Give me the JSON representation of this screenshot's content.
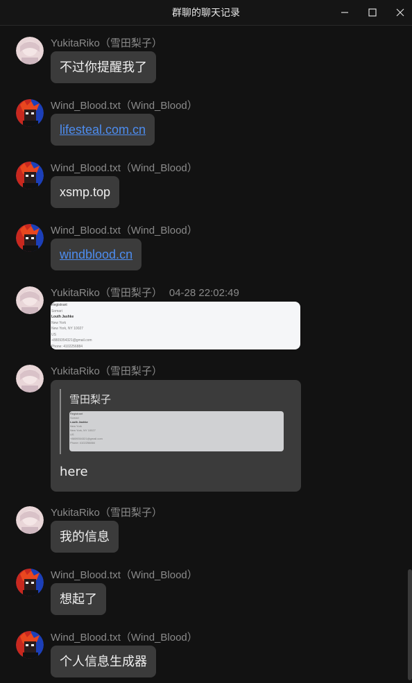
{
  "window": {
    "title": "群聊的聊天记录"
  },
  "messages": [
    {
      "sender": "YukitaRiko（雪田梨子）",
      "text": "不过你提醒我了"
    },
    {
      "sender": "Wind_Blood.txt（Wind_Blood）",
      "text": "lifesteal.com.cn"
    },
    {
      "sender": "Wind_Blood.txt（Wind_Blood）",
      "text": "xsmp.top"
    },
    {
      "sender": "Wind_Blood.txt（Wind_Blood）",
      "text": "windblood.cn"
    },
    {
      "sender": "YukitaRiko（雪田梨子）",
      "time": "04-28 22:02:49",
      "image_lines": [
        "Registrant",
        "Somari",
        "Louth Jashke",
        "New York",
        "New York, NY 10027",
        "US",
        "+8809354321@gmail.com",
        "Phone: 4102256884"
      ]
    },
    {
      "sender": "YukitaRiko（雪田梨子）",
      "quote_name": "雪田梨子",
      "quote_lines": [
        "Registrant",
        "Somari",
        "Louth Jashke",
        "New York",
        "New York, NY 10027",
        "US",
        "+8809354321@gmail.com",
        "Phone: 4102256884"
      ],
      "text": "here"
    },
    {
      "sender": "YukitaRiko（雪田梨子）",
      "text": "我的信息"
    },
    {
      "sender": "Wind_Blood.txt（Wind_Blood）",
      "text": "想起了"
    },
    {
      "sender": "Wind_Blood.txt（Wind_Blood）",
      "text": "个人信息生成器"
    }
  ]
}
